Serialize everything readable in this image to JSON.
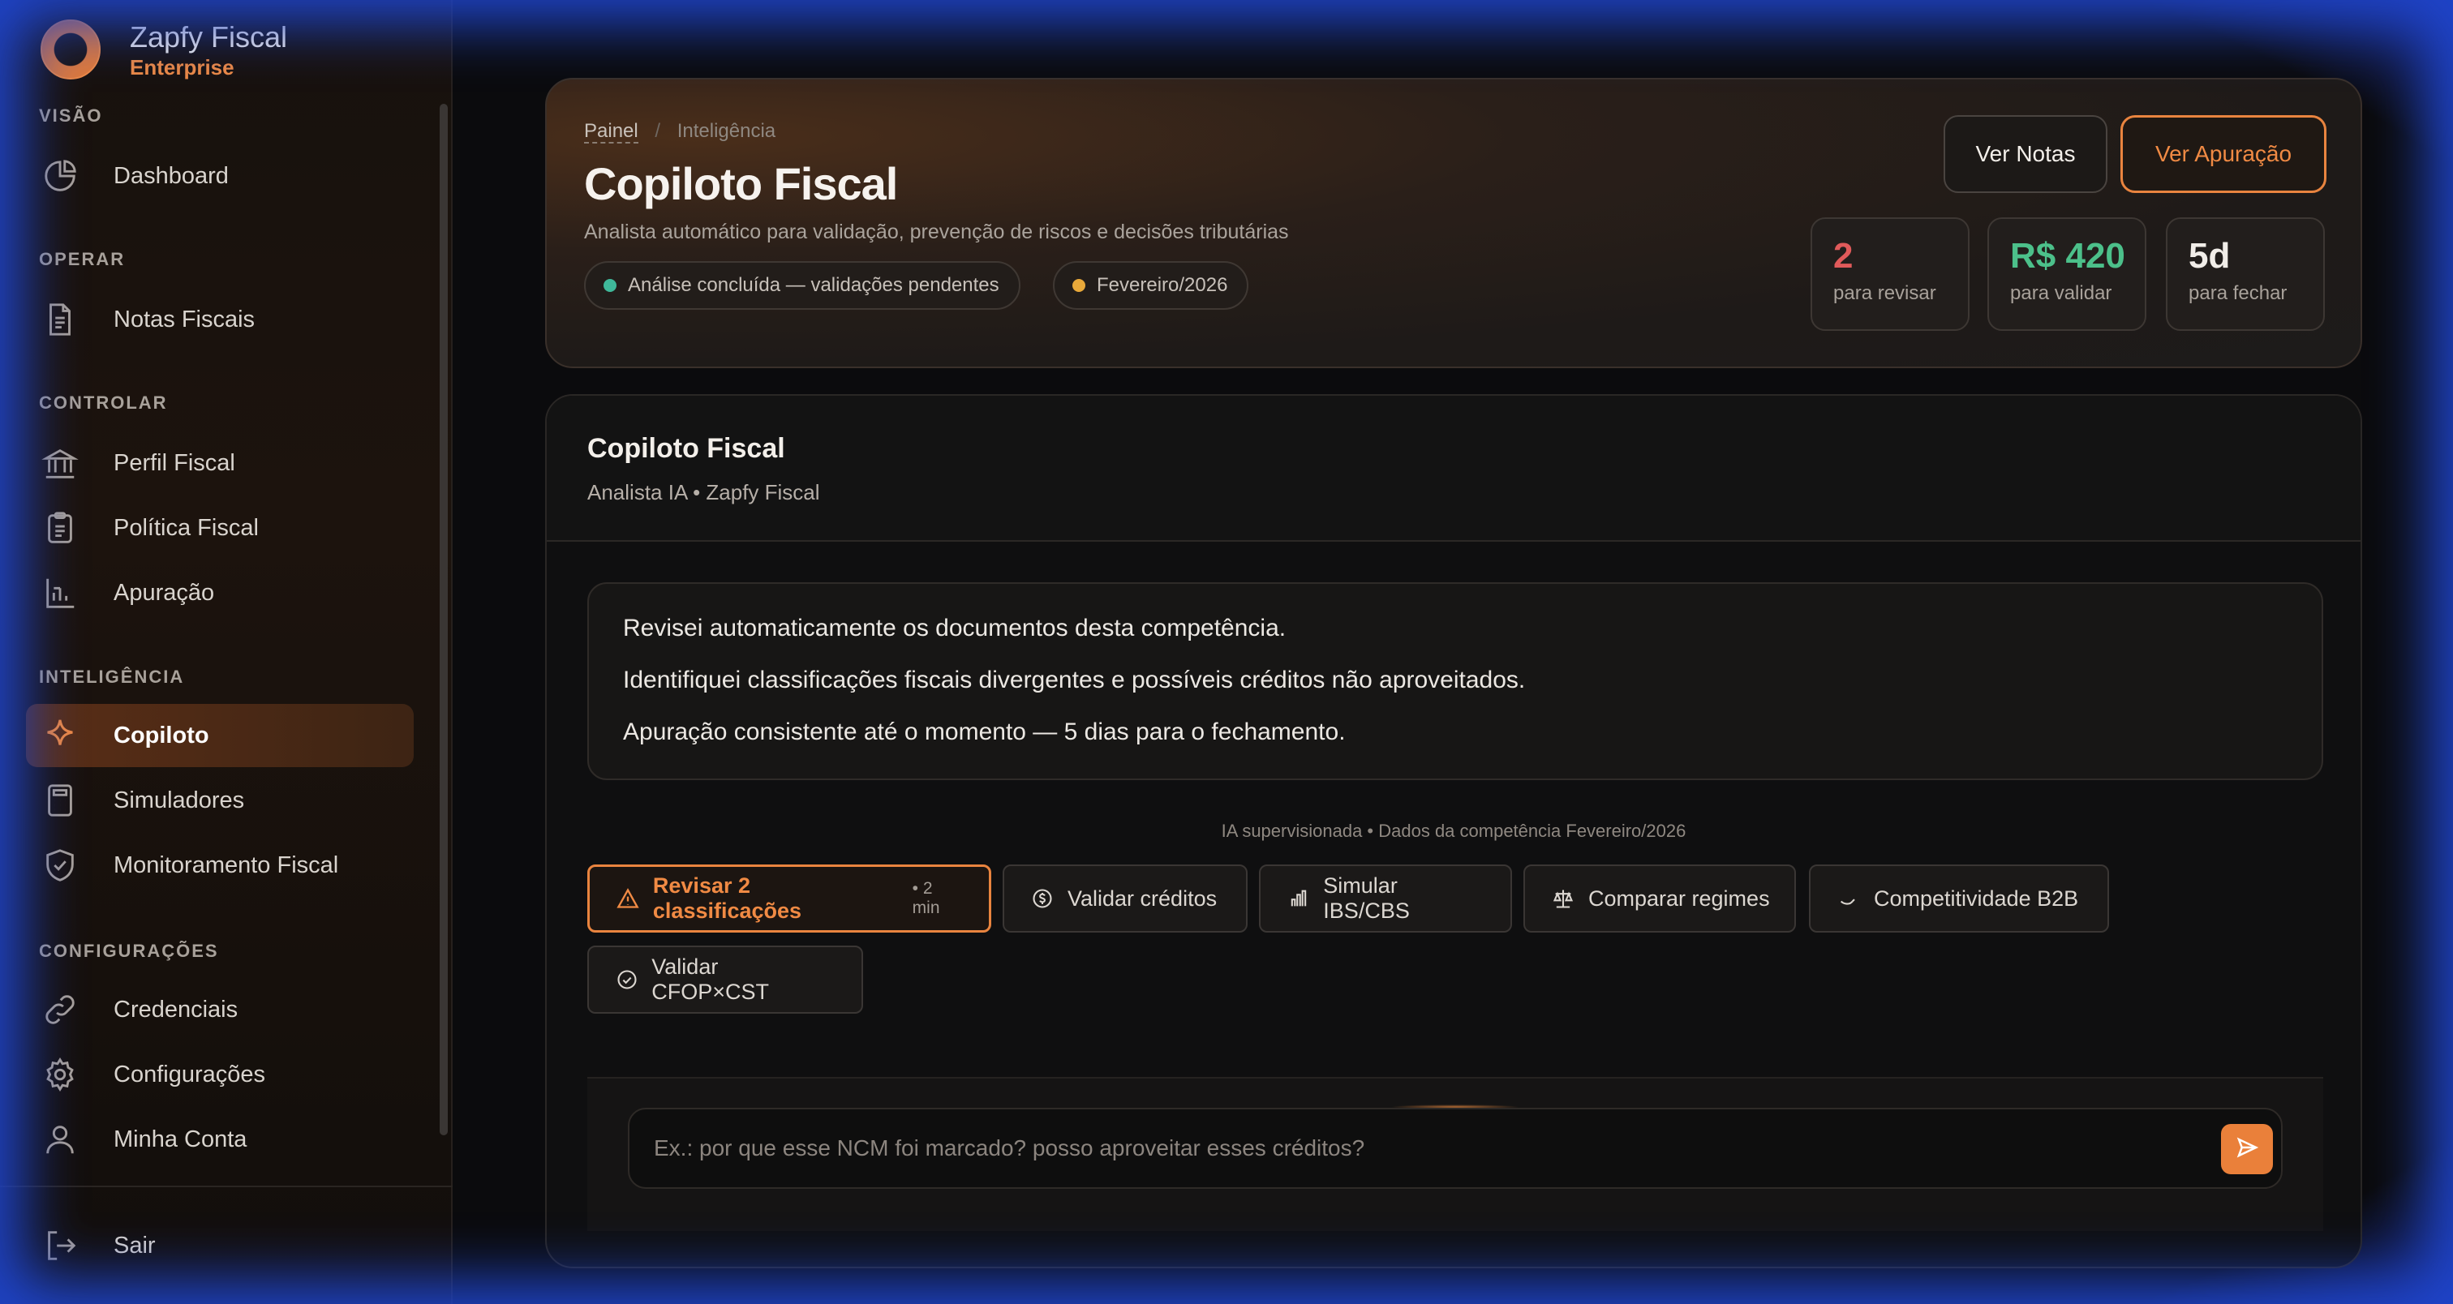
{
  "brand": {
    "name": "Zapfy Fiscal",
    "tier": "Enterprise"
  },
  "sidebar": {
    "sections": [
      {
        "label": "VISÃO",
        "items": [
          {
            "label": "Dashboard",
            "icon": "pie-chart-icon"
          }
        ]
      },
      {
        "label": "OPERAR",
        "items": [
          {
            "label": "Notas Fiscais",
            "icon": "document-icon"
          }
        ]
      },
      {
        "label": "CONTROLAR",
        "items": [
          {
            "label": "Perfil Fiscal",
            "icon": "bank-icon"
          },
          {
            "label": "Política Fiscal",
            "icon": "clipboard-icon"
          },
          {
            "label": "Apuração",
            "icon": "bar-chart-icon"
          }
        ]
      },
      {
        "label": "INTELIGÊNCIA",
        "items": [
          {
            "label": "Copiloto",
            "icon": "sparkle-icon",
            "active": true
          },
          {
            "label": "Simuladores",
            "icon": "calculator-icon"
          },
          {
            "label": "Monitoramento Fiscal",
            "icon": "shield-check-icon"
          }
        ]
      },
      {
        "label": "CONFIGURAÇÕES",
        "items": [
          {
            "label": "Credenciais",
            "icon": "link-icon"
          },
          {
            "label": "Configurações",
            "icon": "gear-icon"
          },
          {
            "label": "Minha Conta",
            "icon": "user-icon"
          }
        ]
      }
    ],
    "logout": "Sair"
  },
  "header": {
    "breadcrumb": {
      "home": "Painel",
      "separator": "/",
      "current": "Inteligência"
    },
    "title": "Copiloto Fiscal",
    "subtitle": "Analista automático para validação, prevenção de riscos e decisões tributárias",
    "pills": [
      {
        "label": "Análise concluída — validações pendentes",
        "dot_color": "#3fb89a"
      },
      {
        "label": "Fevereiro/2026",
        "dot_color": "#e9a93a"
      }
    ],
    "buttons": {
      "notas": "Ver Notas",
      "apuracao": "Ver Apuração"
    },
    "stats": [
      {
        "value": "2",
        "caption": "para revisar",
        "color": "#e05a5a"
      },
      {
        "value": "R$ 420",
        "caption": "para validar",
        "color": "#4cc08a"
      },
      {
        "value": "5d",
        "caption": "para fechar",
        "color": "#f1ede8"
      }
    ]
  },
  "chat": {
    "title": "Copiloto Fiscal",
    "subtitle": "Analista IA • Zapfy Fiscal",
    "message_lines": [
      "Revisei automaticamente os documentos desta competência.",
      "Identifiquei classificações fiscais divergentes e possíveis créditos não aproveitados.",
      "Apuração consistente até o momento — 5 dias para o fechamento."
    ],
    "note": "IA supervisionada • Dados da competência Fevereiro/2026",
    "actions": [
      {
        "label": "Revisar 2 classificações",
        "tag": "• 2 min",
        "icon": "warning-icon"
      },
      {
        "label": "Validar créditos",
        "icon": "dollar-circle-icon"
      },
      {
        "label": "Simular IBS/CBS",
        "icon": "bar-chart-icon"
      },
      {
        "label": "Comparar regimes",
        "icon": "scale-icon"
      },
      {
        "label": "Competitividade B2B",
        "icon": "handshake-icon"
      },
      {
        "label": "Validar CFOP×CST",
        "icon": "check-circle-icon"
      }
    ],
    "composer": {
      "placeholder": "Ex.: por que esse NCM foi marcado? posso aproveitar esses créditos?",
      "value": ""
    }
  },
  "colors": {
    "accent": "#ea803a",
    "danger": "#e05a5a",
    "success": "#4cc08a",
    "focus_frame": "#1f44c8"
  }
}
